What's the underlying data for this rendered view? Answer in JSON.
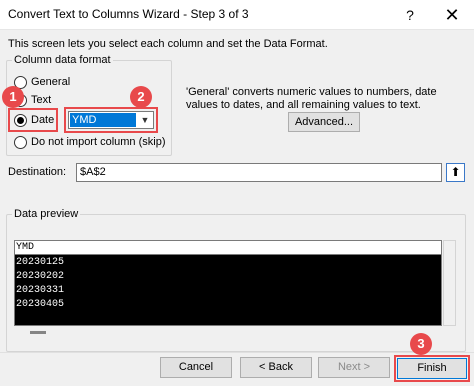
{
  "window": {
    "title": "Convert Text to Columns Wizard - Step 3 of 3",
    "help_glyph": "?",
    "close_glyph": "✕"
  },
  "intro": "This screen lets you select each column and set the Data Format.",
  "column_format": {
    "group_label": "Column data format",
    "options": [
      {
        "label": "General",
        "checked": false
      },
      {
        "label": "Text",
        "checked": false
      },
      {
        "label": "Date",
        "checked": true
      },
      {
        "label": "Do not import column (skip)",
        "checked": false
      }
    ],
    "date_format_value": "YMD"
  },
  "description": "'General' converts numeric values to numbers, date values to dates, and all remaining values to text.",
  "advanced_label": "Advanced...",
  "destination": {
    "label": "Destination:",
    "value": "$A$2"
  },
  "preview": {
    "group_label": "Data preview",
    "header": "YMD",
    "rows": [
      "20230125",
      "20230202",
      "20230331",
      "20230405"
    ]
  },
  "buttons": {
    "cancel": "Cancel",
    "back": "< Back",
    "next": "Next >",
    "finish": "Finish"
  },
  "badges": [
    "1",
    "2",
    "3"
  ],
  "colors": {
    "highlight": "#e8494b",
    "selection": "#0078d7"
  }
}
